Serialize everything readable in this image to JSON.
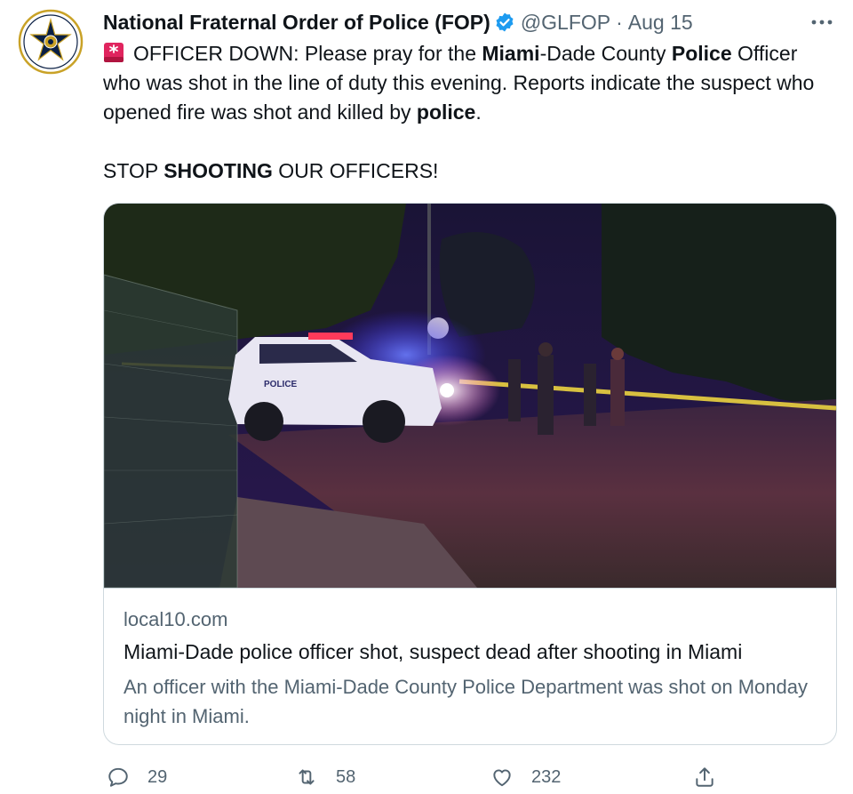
{
  "account": {
    "display_name": "National Fraternal Order of Police (FOP)",
    "handle": "@GLFOP",
    "separator": "·",
    "date": "Aug 15",
    "verified_icon": "verified-badge-icon",
    "avatar_icon": "fop-star-seal"
  },
  "tweet": {
    "line1_emoji": "rotating-light-icon",
    "line1_a": "OFFICER DOWN: Please pray for the ",
    "line1_b": "Miami",
    "line1_c": "-Dade County ",
    "line1_d": "Police",
    "line2_a": "Officer who was shot in the line of duty this evening. Reports indicate the suspect who opened fire was shot and killed by ",
    "line2_b": "police",
    "line2_c": ".",
    "line3_a": "STOP ",
    "line3_b": "SHOOTING",
    "line3_c": " OUR OFFICERS!"
  },
  "card": {
    "domain": "local10.com",
    "title": "Miami-Dade police officer shot, suspect dead after shooting in Miami",
    "description": "An officer with the Miami-Dade County Police Department was shot on Monday night in Miami.",
    "image_text": "POLICE"
  },
  "actions": {
    "reply_count": "29",
    "retweet_count": "58",
    "like_count": "232"
  },
  "colors": {
    "text": "#0f1419",
    "secondary": "#536471",
    "verified": "#1d9bf0",
    "border": "#cfd9de"
  }
}
